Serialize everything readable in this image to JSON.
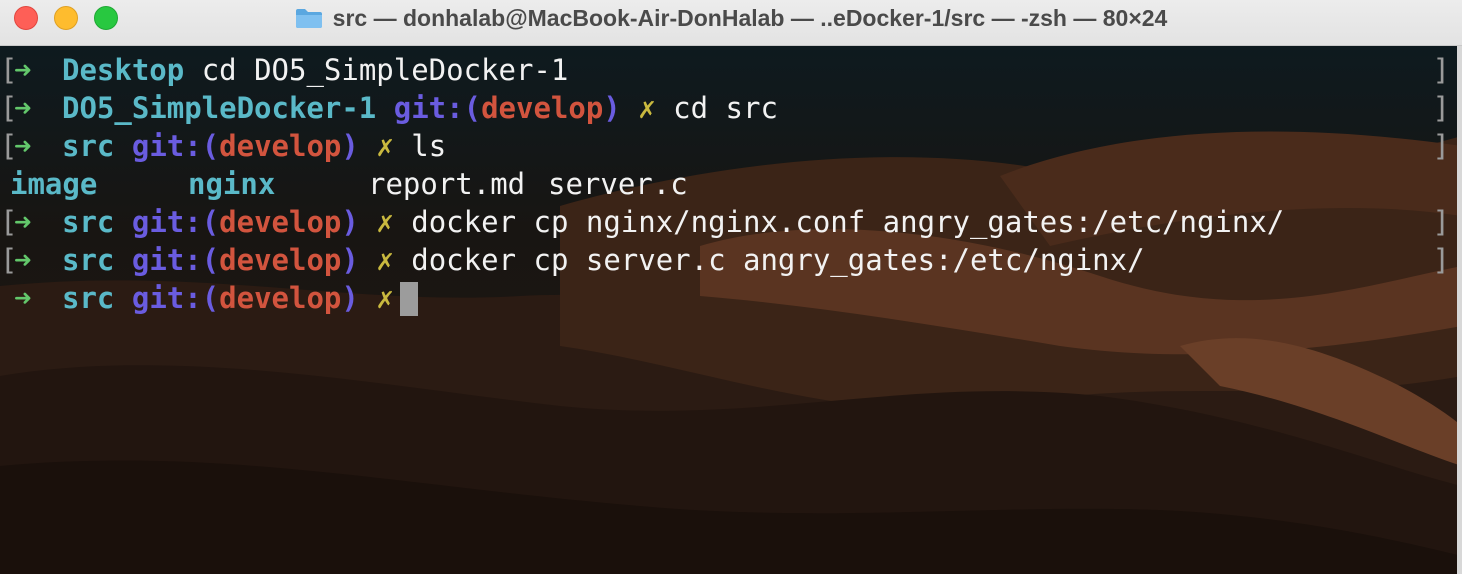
{
  "window": {
    "title": "src — donhalab@MacBook-Air-DonHalab — ..eDocker-1/src — -zsh — 80×24",
    "folder_icon": "folder-icon",
    "traffic_lights": {
      "close": "#fe5f57",
      "minimize": "#febc2e",
      "zoom": "#28c840"
    }
  },
  "prompt": {
    "arrow": "➜",
    "git_open": "git:(",
    "branch": "develop",
    "git_close": ")",
    "dirty_mark": "✗",
    "left_bracket": "[",
    "right_bracket": "]"
  },
  "lines": [
    {
      "dir": "Desktop",
      "command": "cd DO5_SimpleDocker-1"
    },
    {
      "dir": "DO5_SimpleDocker-1",
      "command": "cd src"
    },
    {
      "dir": "src",
      "command": "ls"
    },
    {
      "output": [
        "image",
        "nginx",
        "report.md",
        "server.c"
      ]
    },
    {
      "dir": "src",
      "command": "docker cp nginx/nginx.conf angry_gates:/etc/nginx/"
    },
    {
      "dir": "src",
      "command": "docker cp server.c angry_gates:/etc/nginx/"
    },
    {
      "dir": "src",
      "command": ""
    }
  ],
  "colors": {
    "arrow": "#63c76b",
    "dir": "#5ab9c8",
    "git": "#6a5ce0",
    "branch": "#d2543e",
    "dirty": "#c9b93f",
    "text": "#f2f2f2"
  }
}
